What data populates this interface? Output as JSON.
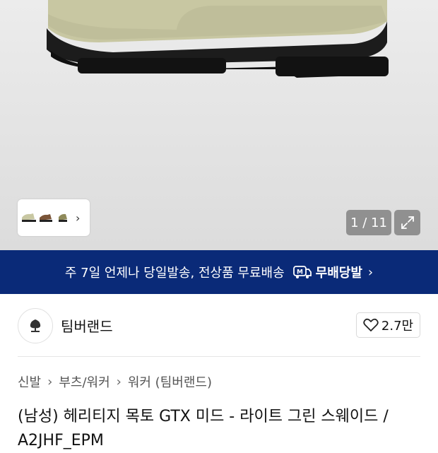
{
  "gallery": {
    "counter": "1 / 11",
    "thumbnail_arrow": "›"
  },
  "banner": {
    "text": "주 7일 언제나 당일발송, 전상품 무료배송",
    "brand": "무배당발",
    "arrow": "›",
    "color": "#0a2a78"
  },
  "brand": {
    "name": "팀버랜드",
    "likes": "2.7만"
  },
  "breadcrumb": [
    "신발",
    "부츠/워커",
    "워커 (팀버랜드)"
  ],
  "product": {
    "title": "(남성) 헤리티지 목토 GTX 미드 - 라이트 그린 스웨이드 / A2JHF_EPM"
  }
}
